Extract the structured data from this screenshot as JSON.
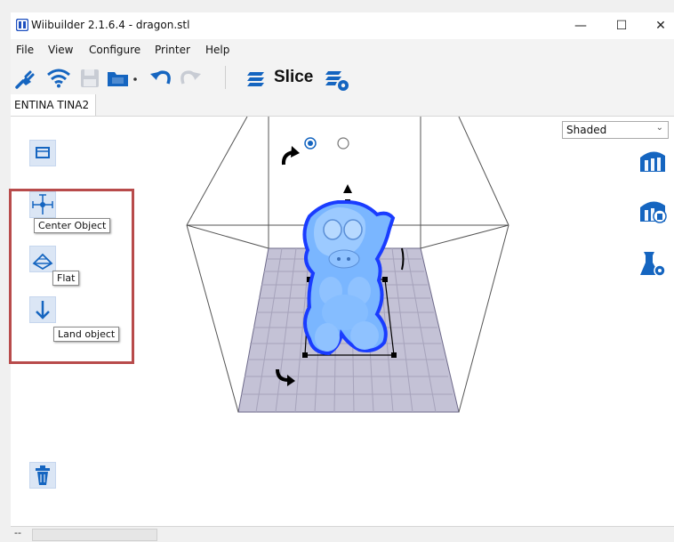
{
  "window": {
    "title": "Wiibuilder 2.1.6.4 - dragon.stl",
    "minimize_glyph": "—",
    "maximize_glyph": "☐",
    "close_glyph": "✕"
  },
  "menubar": {
    "items": [
      {
        "label": "File"
      },
      {
        "label": "View"
      },
      {
        "label": "Configure"
      },
      {
        "label": "Printer"
      },
      {
        "label": "Help"
      }
    ]
  },
  "toolbar": {
    "icons": [
      "plug-icon",
      "wifi-icon",
      "save-icon",
      "open-folder-icon",
      "undo-icon",
      "redo-icon",
      "slice-layers-icon",
      "slice-settings-icon"
    ],
    "slice_label": "Slice"
  },
  "tabs": [
    {
      "label": "ENTINA TINA2",
      "active": true
    }
  ],
  "viewport": {
    "view_mode": {
      "selected": "Shaded"
    },
    "view_radio": {
      "selected_index": 0,
      "count": 2
    },
    "left_tools": [
      {
        "name": "reset-view-icon"
      },
      {
        "name": "center-object-icon",
        "tooltip": "Center Object"
      },
      {
        "name": "flat-icon",
        "tooltip": "Flat"
      },
      {
        "name": "land-object-icon",
        "tooltip": "Land object"
      }
    ],
    "right_tools": [
      "support-icon",
      "support-erase-icon",
      "flask-settings-icon"
    ],
    "delete_icon": "trash-icon",
    "model_color": "#7ab6ff",
    "outline_color": "#1a3cff",
    "highlight_color": "#b84b4b"
  },
  "statusbar": {
    "text": "--"
  }
}
